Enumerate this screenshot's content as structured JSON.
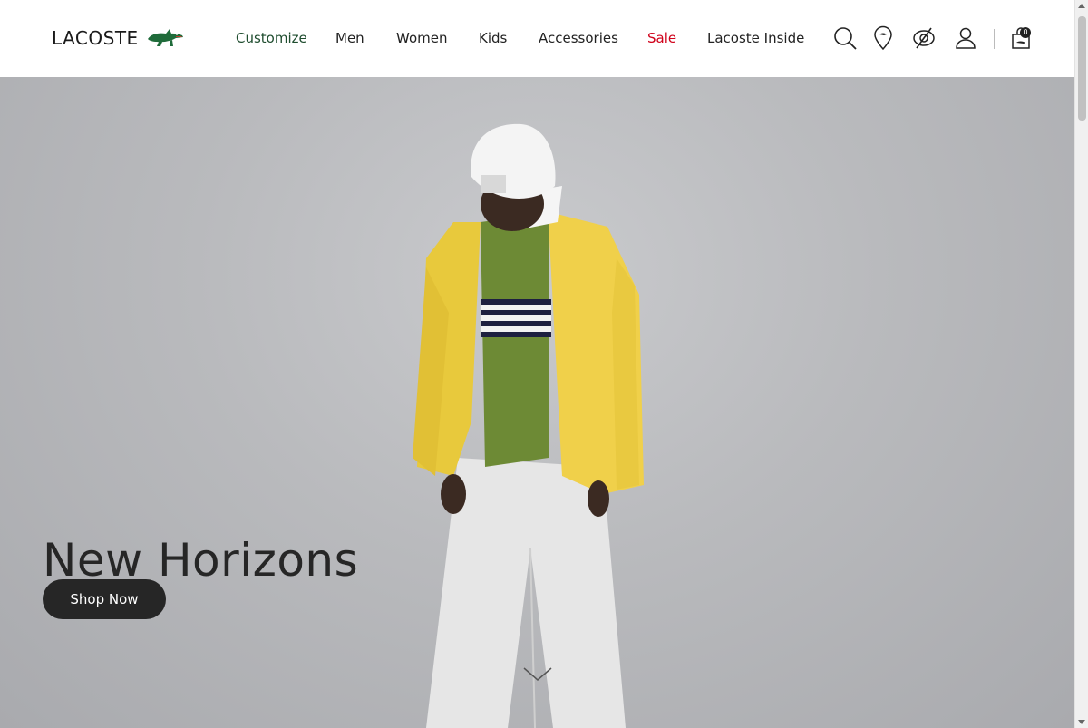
{
  "header": {
    "logo_text": "LACOSTE",
    "nav": [
      {
        "label": "Customize",
        "color": "#1f4d2f"
      },
      {
        "label": "Men",
        "color": "#222222"
      },
      {
        "label": "Women",
        "color": "#222222"
      },
      {
        "label": "Kids",
        "color": "#222222"
      },
      {
        "label": "Accessories",
        "color": "#222222"
      },
      {
        "label": "Sale",
        "color": "#d0021b"
      },
      {
        "label": "Lacoste Inside",
        "color": "#222222"
      }
    ],
    "icons": [
      "search-icon",
      "store-locator-icon",
      "accessibility-icon",
      "account-icon",
      "cart-icon"
    ],
    "cart_count": "0"
  },
  "hero": {
    "title": "New Horizons",
    "button_label": "Shop Now"
  },
  "colors": {
    "brand_green": "#1f4d2f",
    "sale_red": "#d0021b",
    "button_dark": "#262626"
  }
}
